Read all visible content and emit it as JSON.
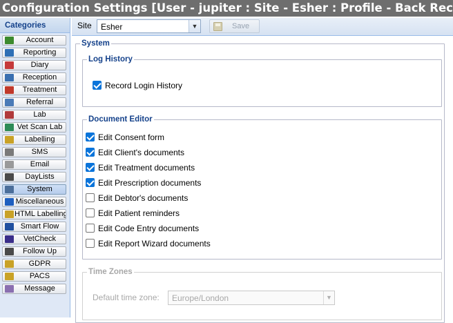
{
  "window": {
    "title": "Configuration Settings [User - jupiter : Site - Esher : Profile - Back Reception ]"
  },
  "sidebar": {
    "header": "Categories",
    "items": [
      {
        "label": "Account",
        "icon": "account-icon",
        "color": "#3c8a2e"
      },
      {
        "label": "Reporting",
        "icon": "reporting-icon",
        "color": "#2e6fb5"
      },
      {
        "label": "Diary",
        "icon": "diary-icon",
        "color": "#c53a3a"
      },
      {
        "label": "Reception",
        "icon": "reception-icon",
        "color": "#3a6fb0"
      },
      {
        "label": "Treatment",
        "icon": "treatment-icon",
        "color": "#c0392b"
      },
      {
        "label": "Referral",
        "icon": "referral-icon",
        "color": "#4a7ab7"
      },
      {
        "label": "Lab",
        "icon": "lab-icon",
        "color": "#b03a3a"
      },
      {
        "label": "Vet Scan Lab",
        "icon": "vet-scan-lab-icon",
        "color": "#2e8b57"
      },
      {
        "label": "Labelling",
        "icon": "labelling-icon",
        "color": "#c9a227"
      },
      {
        "label": "SMS",
        "icon": "sms-icon",
        "color": "#7a7a7a"
      },
      {
        "label": "Email",
        "icon": "email-icon",
        "color": "#9a9a9a"
      },
      {
        "label": "DayLists",
        "icon": "daylists-icon",
        "color": "#4a4a4a"
      },
      {
        "label": "System",
        "icon": "system-icon",
        "color": "#4b6e9a"
      },
      {
        "label": "Miscellaneous",
        "icon": "miscellaneous-icon",
        "color": "#1f5fbf"
      },
      {
        "label": "HTML Labelling",
        "icon": "html-labelling-icon",
        "color": "#c9a227"
      },
      {
        "label": "Smart Flow",
        "icon": "smart-flow-icon",
        "color": "#1f4f9f"
      },
      {
        "label": "VetCheck",
        "icon": "vetcheck-icon",
        "color": "#3a2e8a"
      },
      {
        "label": "Follow Up",
        "icon": "follow-up-icon",
        "color": "#4a4a4a"
      },
      {
        "label": "GDPR",
        "icon": "gdpr-icon",
        "color": "#c9a227"
      },
      {
        "label": "PACS",
        "icon": "pacs-icon",
        "color": "#c9a227"
      },
      {
        "label": "Message",
        "icon": "message-icon",
        "color": "#8a6fb0"
      }
    ],
    "active_index": 12
  },
  "toolbar": {
    "site_label": "Site",
    "site_value": "Esher",
    "save_label": "Save"
  },
  "system": {
    "title": "System",
    "log_history": {
      "title": "Log History",
      "items": [
        {
          "label": "Record Login History",
          "checked": true
        }
      ]
    },
    "document_editor": {
      "title": "Document Editor",
      "items": [
        {
          "label": "Edit Consent form",
          "checked": true
        },
        {
          "label": "Edit Client's documents",
          "checked": true
        },
        {
          "label": "Edit Treatment documents",
          "checked": true
        },
        {
          "label": "Edit Prescription documents",
          "checked": true
        },
        {
          "label": "Edit Debtor's documents",
          "checked": false
        },
        {
          "label": "Edit Patient reminders",
          "checked": false
        },
        {
          "label": "Edit Code Entry documents",
          "checked": false
        },
        {
          "label": "Edit Report Wizard documents",
          "checked": false
        }
      ]
    },
    "time_zones": {
      "title": "Time Zones",
      "default_label": "Default time zone:",
      "default_value": "Europe/London"
    }
  }
}
